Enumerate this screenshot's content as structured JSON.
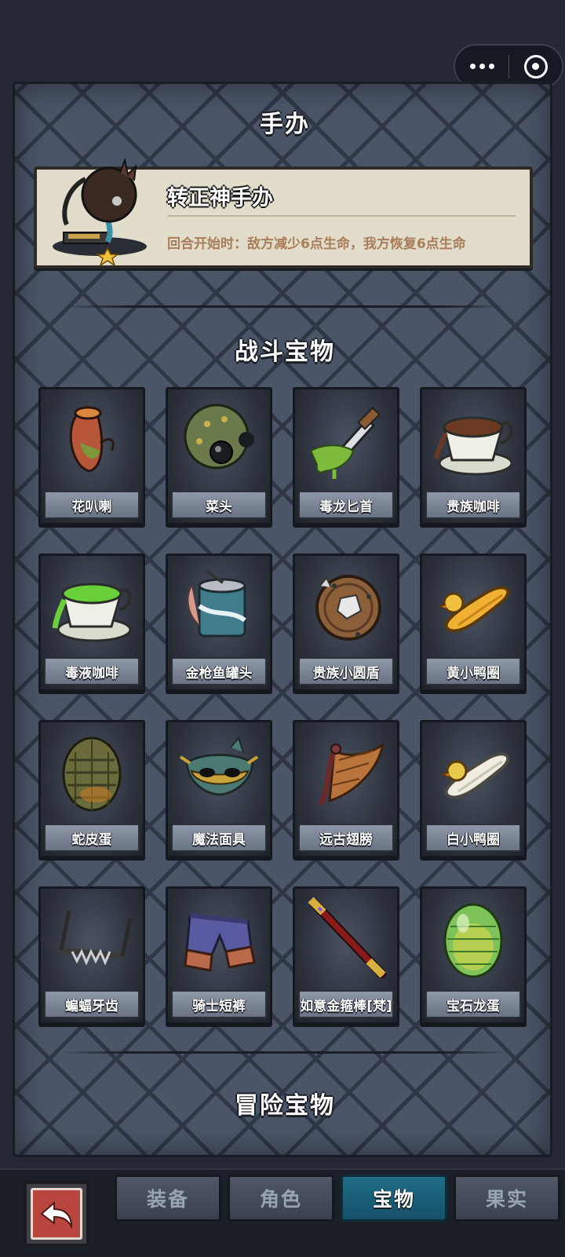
{
  "figure_section": {
    "title": "手办",
    "figure": {
      "name": "转正神手办",
      "description": "回合开始时：敌方减少6点生命，我方恢复6点生命",
      "icon": "figure-statue-icon"
    }
  },
  "battle_section": {
    "title": "战斗宝物",
    "items": [
      {
        "name": "花叭喇",
        "icon": "pitcher-plant-icon"
      },
      {
        "name": "菜头",
        "icon": "cabbage-head-icon"
      },
      {
        "name": "毒龙匕首",
        "icon": "poison-dagger-icon"
      },
      {
        "name": "贵族咖啡",
        "icon": "coffee-cup-icon"
      },
      {
        "name": "毒液咖啡",
        "icon": "poison-coffee-icon"
      },
      {
        "name": "金枪鱼罐头",
        "icon": "tuna-can-icon"
      },
      {
        "name": "贵族小圆盾",
        "icon": "round-shield-icon"
      },
      {
        "name": "黄小鸭圈",
        "icon": "yellow-duck-ring-icon"
      },
      {
        "name": "蛇皮蛋",
        "icon": "snake-egg-icon"
      },
      {
        "name": "魔法面具",
        "icon": "magic-mask-icon"
      },
      {
        "name": "远古翅膀",
        "icon": "ancient-wing-icon"
      },
      {
        "name": "白小鸭圈",
        "icon": "white-duck-ring-icon"
      },
      {
        "name": "蝙蝠牙齿",
        "icon": "bat-teeth-icon"
      },
      {
        "name": "骑士短裤",
        "icon": "knight-shorts-icon"
      },
      {
        "name": "如意金箍棒[梵]",
        "icon": "golden-staff-icon"
      },
      {
        "name": "宝石龙蛋",
        "icon": "gem-dragon-egg-icon"
      }
    ]
  },
  "adventure_section": {
    "title": "冒险宝物"
  },
  "bottom_bar": {
    "back_icon": "back-arrow-icon",
    "tabs": [
      {
        "label": "装备",
        "active": false
      },
      {
        "label": "角色",
        "active": false
      },
      {
        "label": "宝物",
        "active": true
      },
      {
        "label": "果实",
        "active": false
      }
    ]
  },
  "colors": {
    "panel": "#4b5568",
    "active_tab": "#1f6e86",
    "card_bg": "#e2dccb",
    "desc_text": "#a87d5a"
  }
}
